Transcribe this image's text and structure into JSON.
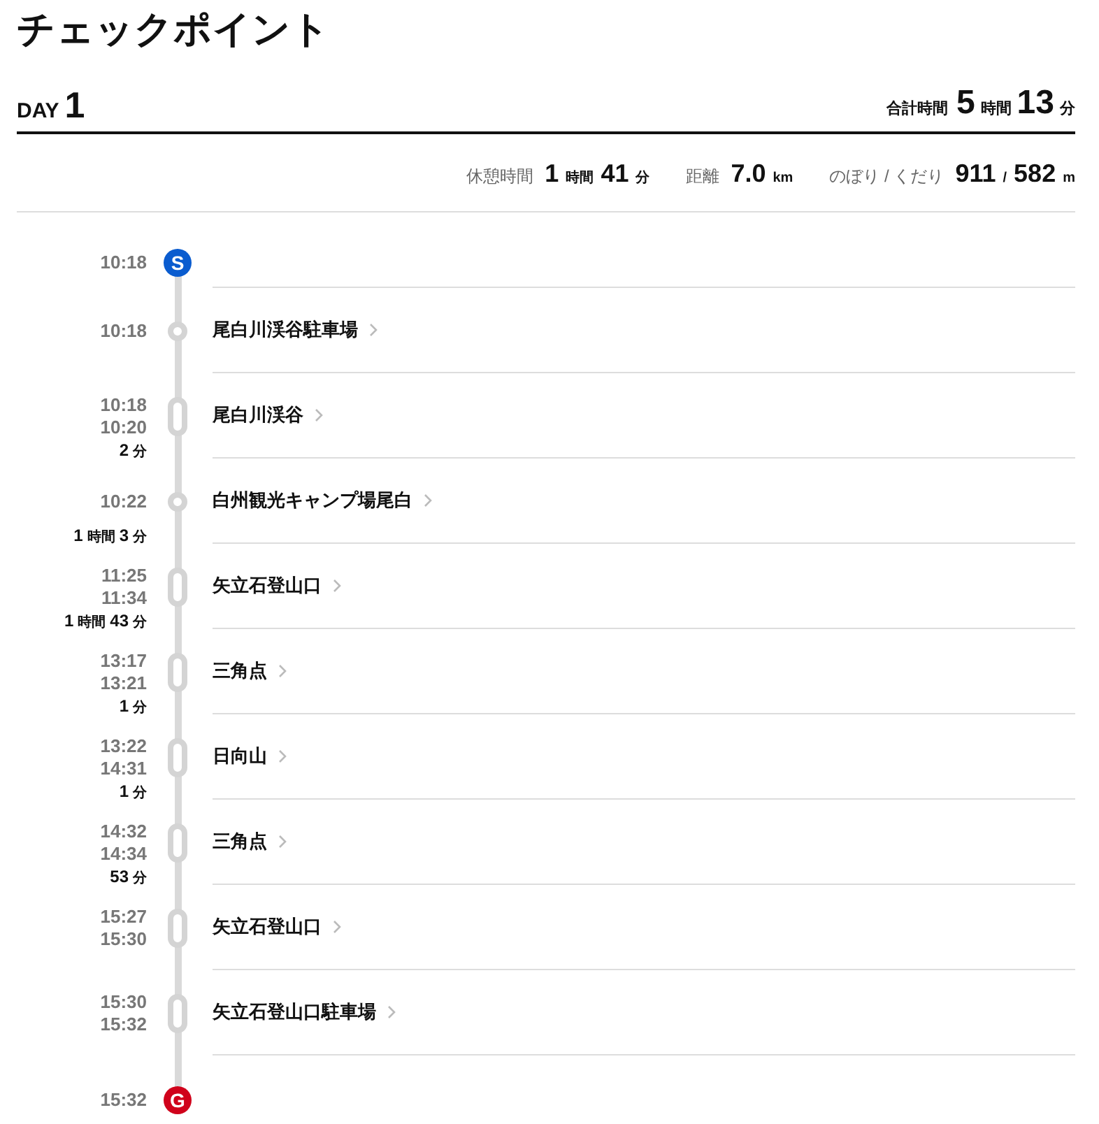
{
  "title": "チェックポイント",
  "day": {
    "label": "DAY",
    "number": "1"
  },
  "total_time": {
    "label": "合計時間",
    "parts": [
      {
        "value": "5",
        "unit": "時間"
      },
      {
        "value": "13",
        "unit": "分"
      }
    ]
  },
  "stats": [
    {
      "label": "休憩時間",
      "parts": [
        {
          "value": "1",
          "unit": "時間"
        },
        {
          "value": "41",
          "unit": "分"
        }
      ]
    },
    {
      "label": "距離",
      "parts": [
        {
          "value": "7.0",
          "unit": "km"
        }
      ]
    },
    {
      "label": "のぼり / くだり",
      "parts": [
        {
          "value": "911",
          "unit": "/"
        },
        {
          "value": "582",
          "unit": "m"
        }
      ]
    }
  ],
  "checkpoints": [
    {
      "kind": "start",
      "times": [
        "10:18"
      ],
      "marker": "S",
      "color": "#0a5ccf"
    },
    {
      "kind": "pass",
      "times": [
        "10:18"
      ],
      "name": "尾白川渓谷駐車場"
    },
    {
      "kind": "stay",
      "times": [
        "10:18",
        "10:20"
      ],
      "name": "尾白川渓谷",
      "duration": [
        {
          "value": "2",
          "unit": "分"
        }
      ]
    },
    {
      "kind": "pass",
      "times": [
        "10:22"
      ],
      "name": "白州観光キャンプ場尾白",
      "duration": [
        {
          "value": "1",
          "unit": "時間"
        },
        {
          "value": "3",
          "unit": "分"
        }
      ]
    },
    {
      "kind": "stay",
      "times": [
        "11:25",
        "11:34"
      ],
      "name": "矢立石登山口",
      "duration": [
        {
          "value": "1",
          "unit": "時間"
        },
        {
          "value": "43",
          "unit": "分"
        }
      ]
    },
    {
      "kind": "stay",
      "times": [
        "13:17",
        "13:21"
      ],
      "name": "三角点",
      "duration": [
        {
          "value": "1",
          "unit": "分"
        }
      ]
    },
    {
      "kind": "stay",
      "times": [
        "13:22",
        "14:31"
      ],
      "name": "日向山",
      "duration": [
        {
          "value": "1",
          "unit": "分"
        }
      ]
    },
    {
      "kind": "stay",
      "times": [
        "14:32",
        "14:34"
      ],
      "name": "三角点",
      "duration": [
        {
          "value": "53",
          "unit": "分"
        }
      ]
    },
    {
      "kind": "stay",
      "times": [
        "15:27",
        "15:30"
      ],
      "name": "矢立石登山口"
    },
    {
      "kind": "stay",
      "times": [
        "15:30",
        "15:32"
      ],
      "name": "矢立石登山口駐車場"
    },
    {
      "kind": "goal",
      "times": [
        "15:32"
      ],
      "marker": "G",
      "color": "#d0021b"
    }
  ]
}
